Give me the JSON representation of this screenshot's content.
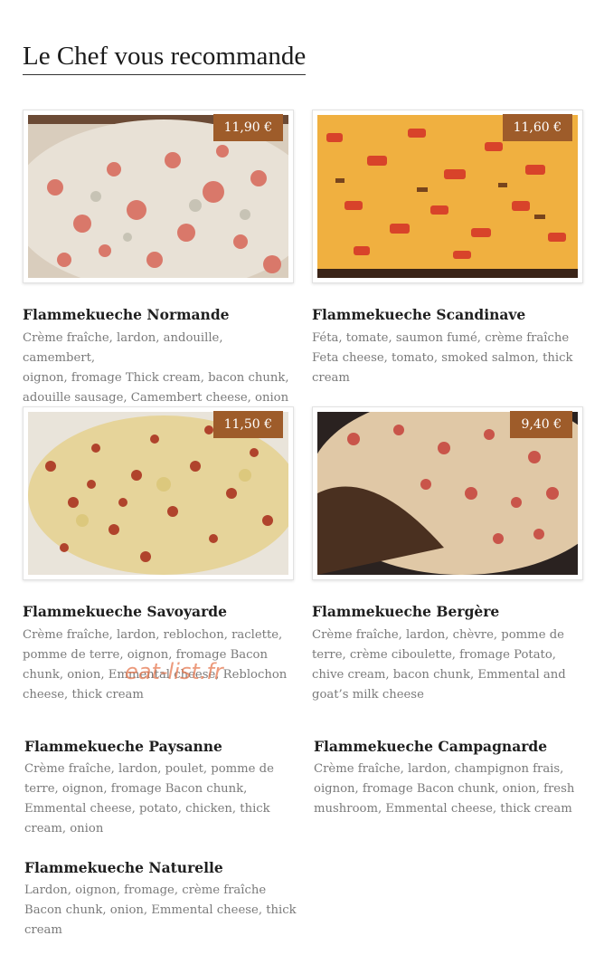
{
  "section_title": "Le Chef vous recommande",
  "watermark": "eat-list.fr",
  "items": [
    {
      "name": "Flammekueche Normande",
      "price": "11,90 €",
      "desc_fr": "Crème fraîche, lardon, andouille, camembert,",
      "desc_en": "oignon, fromage Thick cream, bacon chunk, adouille sausage, Camembert cheese, onion"
    },
    {
      "name": "Flammekueche Scandinave",
      "price": "11,60 €",
      "desc_fr": "Féta, tomate, saumon fumé, crème fraîche",
      "desc_en": "Feta cheese, tomato, smoked salmon, thick cream"
    },
    {
      "name": "Flammekueche Savoyarde",
      "price": "11,50 €",
      "desc_fr": "Crème fraîche, lardon, reblochon, raclette,",
      "desc_en": "pomme de terre, oignon, fromage Bacon chunk, onion, Emmental cheese, Reblochon cheese, thick cream"
    },
    {
      "name": "Flammekueche Bergère",
      "price": "9,40 €",
      "desc_fr": "Crème fraîche, lardon, chèvre, pomme de",
      "desc_en": "terre, crème ciboulette, fromage Potato, chive cream, bacon chunk, Emmental and goat’s milk cheese"
    },
    {
      "name": "Flammekueche Paysanne",
      "desc_fr": "Crème fraîche, lardon, poulet, pomme de",
      "desc_en": "terre, oignon, fromage Bacon chunk, Emmental cheese, potato, chicken, thick cream, onion"
    },
    {
      "name": "Flammekueche Campagnarde",
      "desc_fr": "Crème fraîche, lardon, champignon frais,",
      "desc_en": "oignon, fromage Bacon chunk, onion, fresh mushroom, Emmental cheese, thick cream"
    },
    {
      "name": "Flammekueche Naturelle",
      "desc_fr": "Lardon, oignon, fromage, crème fraîche",
      "desc_en": "Bacon chunk, onion, Emmental cheese, thick cream"
    }
  ]
}
